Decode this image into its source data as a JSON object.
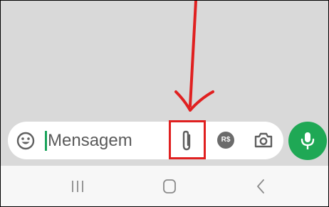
{
  "composer": {
    "placeholder": "Mensagem",
    "payment_label": "R$"
  },
  "icons": {
    "emoji": "emoji-icon",
    "attach": "paperclip-icon",
    "payment": "payment-icon",
    "camera": "camera-icon",
    "mic": "microphone-icon",
    "nav_recents": "recents-icon",
    "nav_home": "home-icon",
    "nav_back": "back-icon",
    "annotation": "arrow-annotation"
  },
  "colors": {
    "background": "#d9d9d9",
    "input_bg": "#ffffff",
    "accent_green": "#1fa855",
    "annotation_red": "#e02020",
    "icon_gray": "#5f5f5f"
  }
}
